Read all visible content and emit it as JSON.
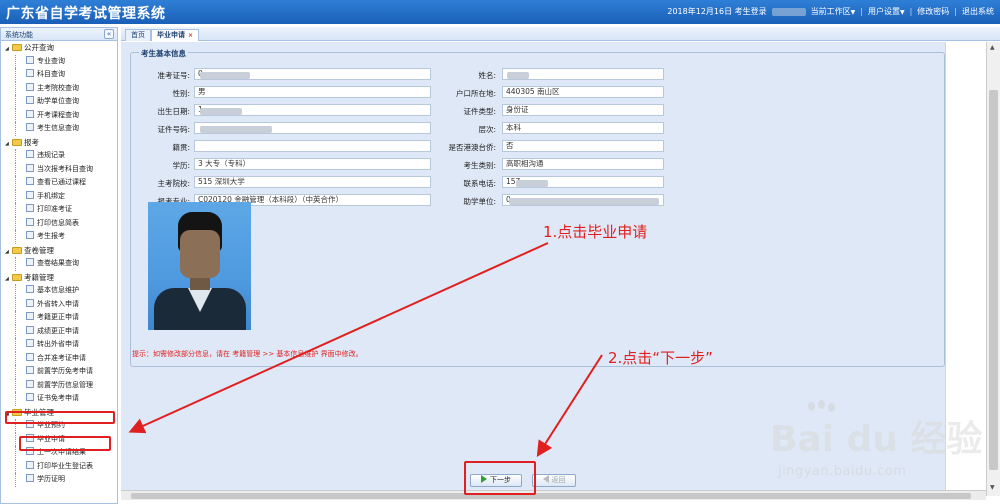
{
  "header": {
    "title": "广东省自学考试管理系统",
    "date_text": "2018年12月16日 考生登录",
    "workspace": "当前工作区",
    "user_settings": "用户设置",
    "change_password": "修改密码",
    "logout": "退出系统",
    "colors": {
      "bar": "#1a5fb8",
      "text": "#ffffff"
    }
  },
  "sidebar": {
    "title": "系统功能",
    "collapse_icon": "«",
    "groups": [
      {
        "label": "公开查询",
        "items": [
          "专业查询",
          "科目查询",
          "主考院校查询",
          "助学单位查询",
          "开考课程查询",
          "考生信息查询"
        ]
      },
      {
        "label": "报考",
        "items": [
          "违规记录",
          "当次报考科目查询",
          "查看已通过课程",
          "手机绑定",
          "打印准考证",
          "打印信息简表",
          "考生报考"
        ]
      },
      {
        "label": "查卷管理",
        "items": [
          "查卷结果查询"
        ]
      },
      {
        "label": "考籍管理",
        "items": [
          "基本信息维护",
          "外省转入申请",
          "考籍更正申请",
          "成绩更正申请",
          "转出外省申请",
          "合并准考证申请",
          "前置学历免考申请",
          "前置学历信息管理",
          "证书免考申请"
        ]
      },
      {
        "label": "毕业管理",
        "items": [
          "毕业预约",
          "毕业申请",
          "上一次申请结果",
          "打印毕业生登记表",
          "学历证明"
        ]
      }
    ]
  },
  "tabs": [
    {
      "label": "首页"
    },
    {
      "label": "毕业申请",
      "close": "×"
    }
  ],
  "form": {
    "legend": "考生基本信息",
    "left_fields": [
      {
        "label": "准考证号:",
        "value": "0"
      },
      {
        "label": "性别:",
        "value": "男"
      },
      {
        "label": "出生日期:",
        "value": "1"
      },
      {
        "label": "证件号码:",
        "value": ""
      },
      {
        "label": "籍贯:",
        "value": ""
      },
      {
        "label": "学历:",
        "value": "3 大专（专科）"
      },
      {
        "label": "主考院校:",
        "value": "515 深圳大学"
      },
      {
        "label": "报考专业:",
        "value": "C020120 金融管理（本科段）（中英合作）"
      }
    ],
    "right_fields": [
      {
        "label": "姓名:",
        "value": ""
      },
      {
        "label": "户口所在地:",
        "value": "440305 南山区"
      },
      {
        "label": "证件类型:",
        "value": "身份证"
      },
      {
        "label": "层次:",
        "value": "本科"
      },
      {
        "label": "是否港澳台侨:",
        "value": "否"
      },
      {
        "label": "考生类别:",
        "value": "高职相沟通"
      },
      {
        "label": "联系电话:",
        "value": "157"
      },
      {
        "label": "助学单位:",
        "value": "0"
      }
    ],
    "tip": "提示：如需修改部分信息，请在 考籍管理 >> 基本信息维护 界面中修改。"
  },
  "buttons": {
    "next": "下一步",
    "back": "返回"
  },
  "annotations": {
    "step1": "1.点击毕业申请",
    "step2": "2.点击“下一步”",
    "color": "#e02020"
  },
  "watermark": {
    "logo": "Bai du 经验",
    "url": "jingyan.baidu.com"
  }
}
